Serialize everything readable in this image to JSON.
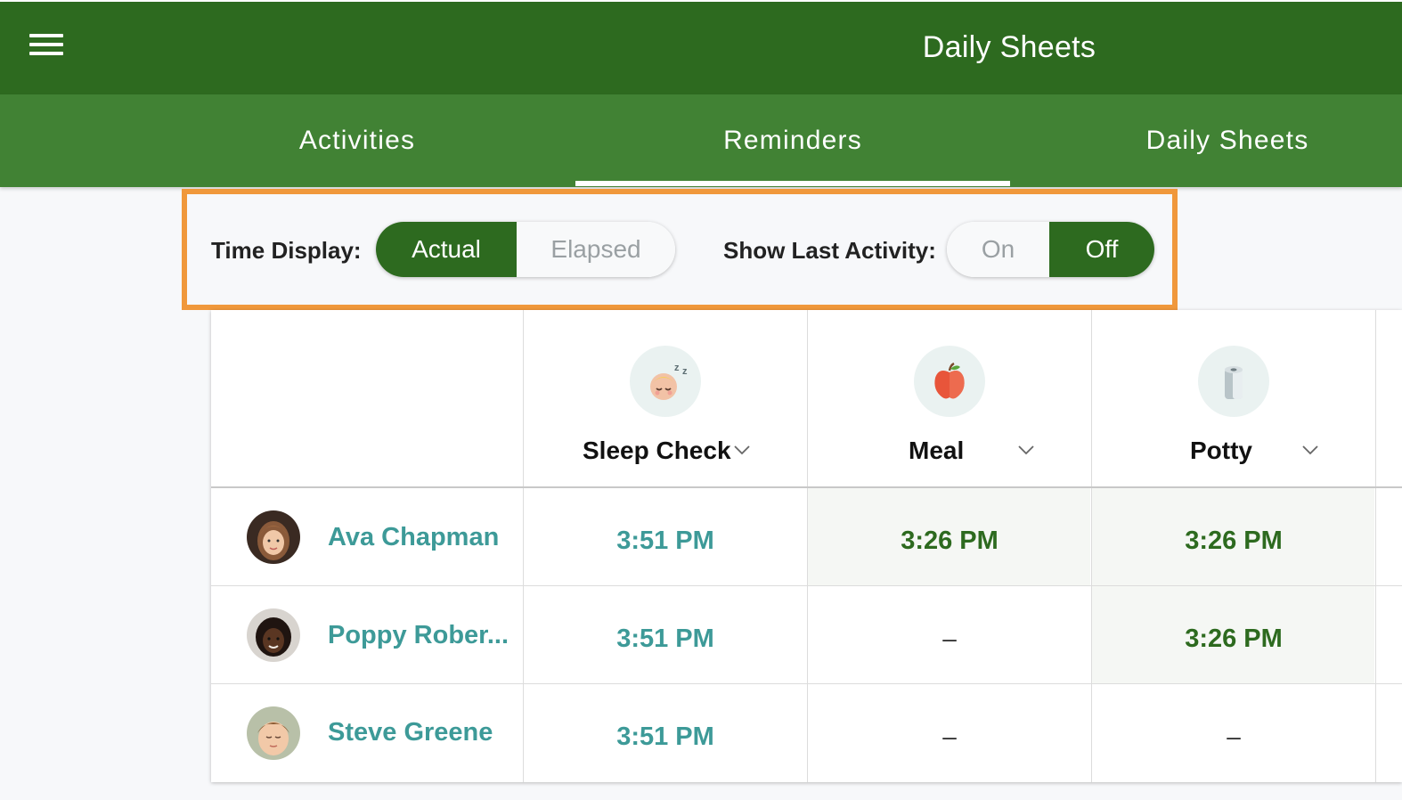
{
  "app_bar": {
    "title": "Daily Sheets",
    "menu_icon": "hamburger-menu-icon"
  },
  "tabs": [
    {
      "label": "Activities",
      "active": false
    },
    {
      "label": "Reminders",
      "active": true
    },
    {
      "label": "Daily Sheets",
      "active": false
    }
  ],
  "controls": {
    "time_display": {
      "label": "Time Display:",
      "options": [
        "Actual",
        "Elapsed"
      ],
      "selected": "Actual"
    },
    "show_last_activity": {
      "label": "Show Last Activity:",
      "options": [
        "On",
        "Off"
      ],
      "selected": "Off"
    },
    "highlight_color": "#f0983b"
  },
  "table": {
    "columns": [
      {
        "title": "Sleep Check",
        "icon": "sleeping-baby-icon"
      },
      {
        "title": "Meal",
        "icon": "apple-icon"
      },
      {
        "title": "Potty",
        "icon": "toilet-paper-icon"
      }
    ],
    "rows": [
      {
        "name": "Ava Chapman",
        "cells": [
          "3:51 PM",
          "3:26 PM",
          "3:26 PM"
        ]
      },
      {
        "name": "Poppy Rober...",
        "cells": [
          "3:51 PM",
          "–",
          "3:26 PM"
        ]
      },
      {
        "name": "Steve Greene",
        "cells": [
          "3:51 PM",
          "–",
          "–"
        ]
      }
    ]
  },
  "colors": {
    "app_bar": "#2d6a1f",
    "tab_bar": "#418234",
    "name_teal": "#3d9a98"
  }
}
